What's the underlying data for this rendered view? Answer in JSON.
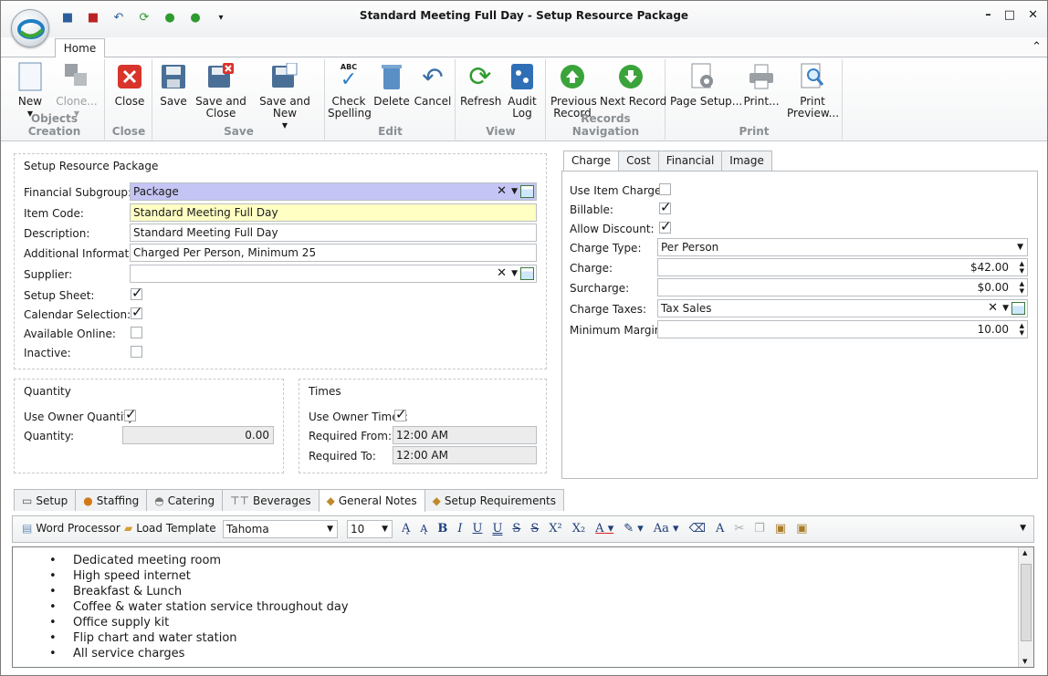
{
  "window": {
    "title": "Standard Meeting Full Day - Setup Resource Package"
  },
  "ribbon": {
    "tab": "Home",
    "groups": [
      {
        "label": "Objects Creation",
        "buttons": [
          {
            "label": "New",
            "icon": "new-doc-icon"
          },
          {
            "label": "Clone...",
            "icon": "clone-icon",
            "disabled": true
          }
        ]
      },
      {
        "label": "Close",
        "buttons": [
          {
            "label": "Close",
            "icon": "close-icon"
          }
        ]
      },
      {
        "label": "Save",
        "buttons": [
          {
            "label": "Save",
            "icon": "save-icon"
          },
          {
            "label": "Save and Close",
            "icon": "save-close-icon"
          },
          {
            "label": "Save and New",
            "icon": "save-new-icon"
          }
        ]
      },
      {
        "label": "Edit",
        "buttons": [
          {
            "label": "Check Spelling",
            "icon": "spell-check-icon"
          },
          {
            "label": "Delete",
            "icon": "delete-icon"
          },
          {
            "label": "Cancel",
            "icon": "undo-icon"
          }
        ]
      },
      {
        "label": "View",
        "buttons": [
          {
            "label": "Refresh",
            "icon": "refresh-icon"
          },
          {
            "label": "Audit Log",
            "icon": "audit-log-icon"
          }
        ]
      },
      {
        "label": "Records Navigation",
        "buttons": [
          {
            "label": "Previous Record",
            "icon": "up-arrow-icon"
          },
          {
            "label": "Next Record",
            "icon": "down-arrow-icon"
          }
        ]
      },
      {
        "label": "Print",
        "buttons": [
          {
            "label": "Page Setup...",
            "icon": "page-setup-icon"
          },
          {
            "label": "Print...",
            "icon": "printer-icon"
          },
          {
            "label": "Print Preview...",
            "icon": "print-preview-icon"
          }
        ]
      }
    ]
  },
  "setup": {
    "title": "Setup Resource Package",
    "financial_subgroup_label": "Financial Subgroup:",
    "financial_subgroup": "Package",
    "item_code_label": "Item Code:",
    "item_code": "Standard Meeting Full Day",
    "description_label": "Description:",
    "description": "Standard Meeting Full Day",
    "additional_info_label": "Additional Information:",
    "additional_info": "Charged Per Person, Minimum 25",
    "supplier_label": "Supplier:",
    "supplier": "",
    "setup_sheet_label": "Setup Sheet:",
    "calendar_selection_label": "Calendar Selection:",
    "available_online_label": "Available Online:",
    "inactive_label": "Inactive:"
  },
  "quantity": {
    "title": "Quantity",
    "use_owner_label": "Use Owner Quantity:",
    "quantity_label": "Quantity:",
    "quantity": "0.00"
  },
  "times": {
    "title": "Times",
    "use_owner_label": "Use Owner Times:",
    "from_label": "Required From:",
    "from": "12:00 AM",
    "to_label": "Required To:",
    "to": "12:00 AM"
  },
  "right_tabs": [
    "Charge",
    "Cost",
    "Financial",
    "Image"
  ],
  "charge": {
    "use_item_label": "Use Item Charges:",
    "billable_label": "Billable:",
    "allow_discount_label": "Allow Discount:",
    "charge_type_label": "Charge Type:",
    "charge_type": "Per Person",
    "charge_label": "Charge:",
    "charge": "$42.00",
    "surcharge_label": "Surcharge:",
    "surcharge": "$0.00",
    "taxes_label": "Charge Taxes:",
    "taxes": "Tax Sales",
    "min_margin_label": "Minimum Margin:",
    "min_margin": "10.00"
  },
  "bottom_tabs": [
    "Setup",
    "Staffing",
    "Catering",
    "Beverages",
    "General Notes",
    "Setup Requirements"
  ],
  "toolbar": {
    "word_processor": "Word Processor",
    "load_template": "Load Template",
    "font": "Tahoma",
    "size": "10"
  },
  "notes": [
    "Dedicated meeting room",
    "High speed internet",
    "Breakfast & Lunch",
    "Coffee & water station service throughout day",
    "Office supply kit",
    "Flip chart and water station",
    "All service charges"
  ]
}
